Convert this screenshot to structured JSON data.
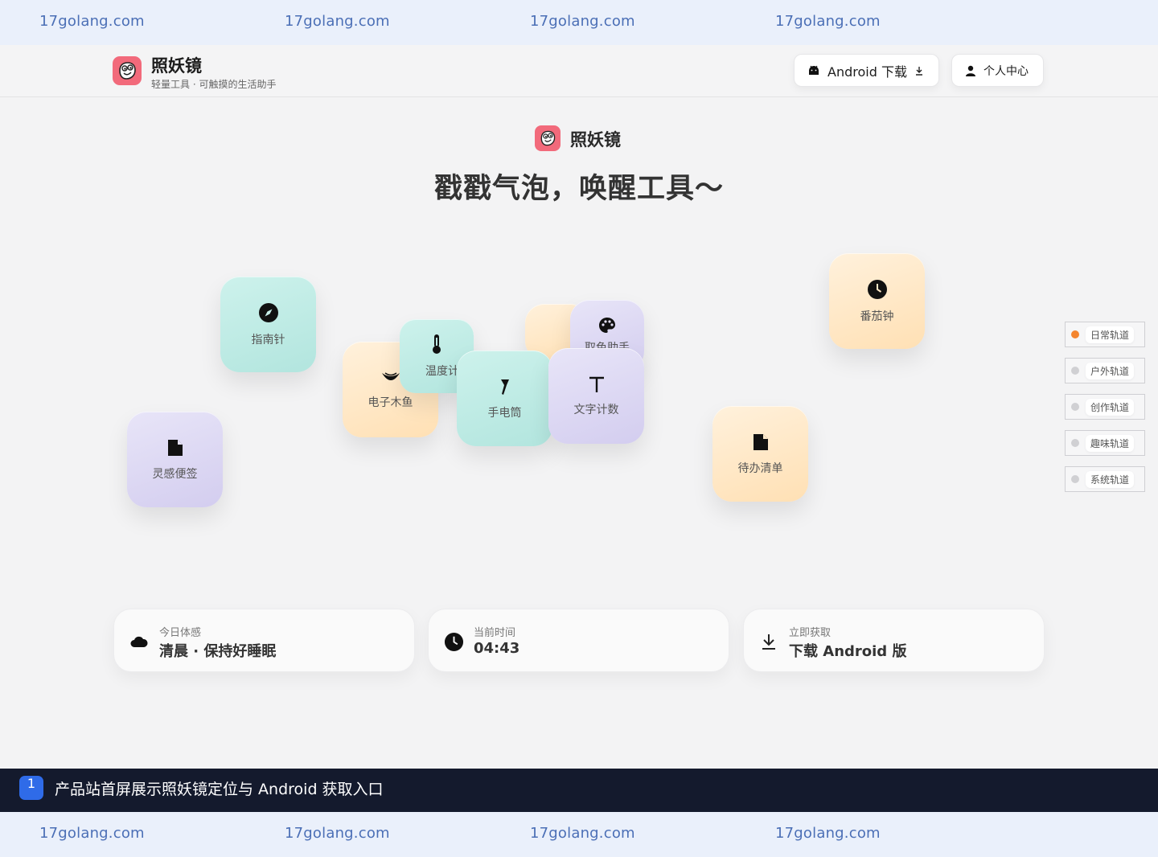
{
  "watermark": {
    "text": "17golang.com"
  },
  "header": {
    "brand_name": "照妖镜",
    "brand_tagline": "轻量工具 · 可触摸的生活助手",
    "android_button": "Android 下载",
    "profile_button": "个人中心"
  },
  "hero": {
    "brand_name": "照妖镜",
    "title": "戳戳气泡，唤醒工具～"
  },
  "bubbles": {
    "compass": "指南针",
    "thermometer": "温度计",
    "wooden_fish": "电子木鱼",
    "palette_partial": "取色助手",
    "flashlight": "手电筒",
    "word_count": "文字计数",
    "pomodoro": "番茄钟",
    "todo": "待办清单",
    "notes": "灵感便签"
  },
  "tracks": [
    {
      "label": "日常轨道",
      "active": true
    },
    {
      "label": "户外轨道",
      "active": false
    },
    {
      "label": "创作轨道",
      "active": false
    },
    {
      "label": "趣味轨道",
      "active": false
    },
    {
      "label": "系统轨道",
      "active": false
    }
  ],
  "cards": {
    "mood": {
      "sub": "今日体感",
      "main": "清晨 · 保持好睡眠"
    },
    "time": {
      "sub": "当前时间",
      "main": "04:43"
    },
    "get": {
      "sub": "立即获取",
      "main": "下载 Android 版"
    }
  },
  "caption": {
    "number": "1",
    "text": "产品站首屏展示照妖镜定位与 Android 获取入口"
  },
  "colors": {
    "brand_pink": "#f26a7b",
    "teal": "#b2e5de",
    "peach": "#ffe0b4",
    "lavender": "#d3cdef",
    "track_active": "#f4852f",
    "caption_bg": "#141a2d",
    "badge_blue": "#2f6be8"
  },
  "icons": {
    "compass": "compass-icon",
    "thermometer": "thermometer-icon",
    "wooden_fish": "wooden-fish-icon",
    "palette": "palette-icon",
    "flashlight": "flashlight-icon",
    "text": "text-icon",
    "clock": "clock-icon",
    "file": "file-icon",
    "cloud": "cloud-icon",
    "download": "download-icon",
    "android": "android-icon",
    "user": "user-icon"
  }
}
